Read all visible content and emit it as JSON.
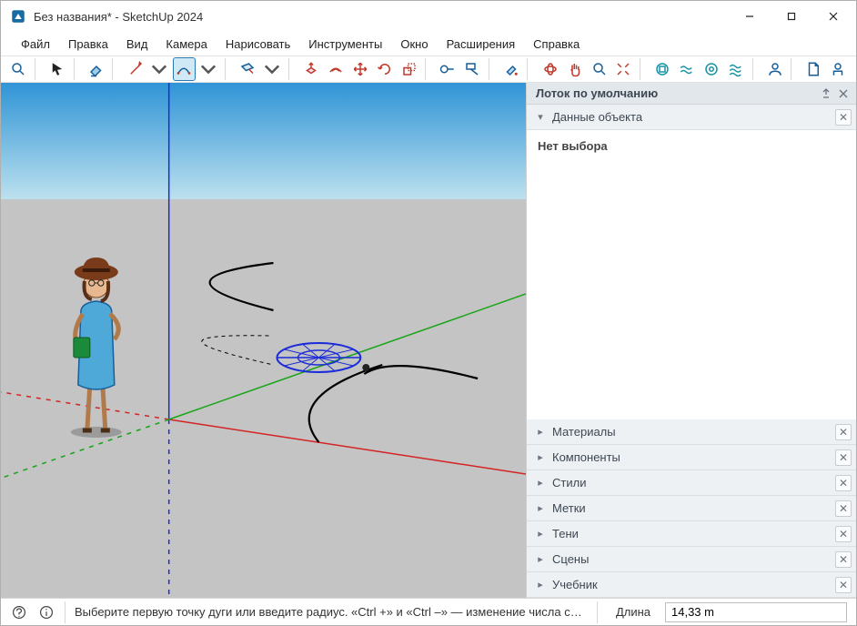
{
  "window": {
    "title": "Без названия* - SketchUp 2024"
  },
  "menu": {
    "items": [
      "Файл",
      "Правка",
      "Вид",
      "Камера",
      "Нарисовать",
      "Инструменты",
      "Окно",
      "Расширения",
      "Справка"
    ]
  },
  "toolbar": {
    "active_tool": "arc-2point"
  },
  "tray": {
    "title": "Лоток по умолчанию",
    "panels": [
      {
        "id": "entity-info",
        "label": "Данные объекта",
        "expanded": true,
        "body": "Нет выбора"
      },
      {
        "id": "materials",
        "label": "Материалы",
        "expanded": false
      },
      {
        "id": "components",
        "label": "Компоненты",
        "expanded": false
      },
      {
        "id": "styles",
        "label": "Стили",
        "expanded": false
      },
      {
        "id": "tags",
        "label": "Метки",
        "expanded": false
      },
      {
        "id": "shadows",
        "label": "Тени",
        "expanded": false
      },
      {
        "id": "scenes",
        "label": "Сцены",
        "expanded": false
      },
      {
        "id": "instructor",
        "label": "Учебник",
        "expanded": false
      }
    ]
  },
  "status": {
    "hint": "Выберите первую точку дуги или введите радиус. «Ctrl +» и «Ctrl –» — изменение числа се…",
    "measure_label": "Длина",
    "measure_value": "14,33 m"
  },
  "colors": {
    "accent": "#165f9a",
    "accent_red": "#c0392b",
    "axis_blue": "#1b2bd8",
    "axis_green": "#18a518",
    "axis_red": "#d42323"
  }
}
